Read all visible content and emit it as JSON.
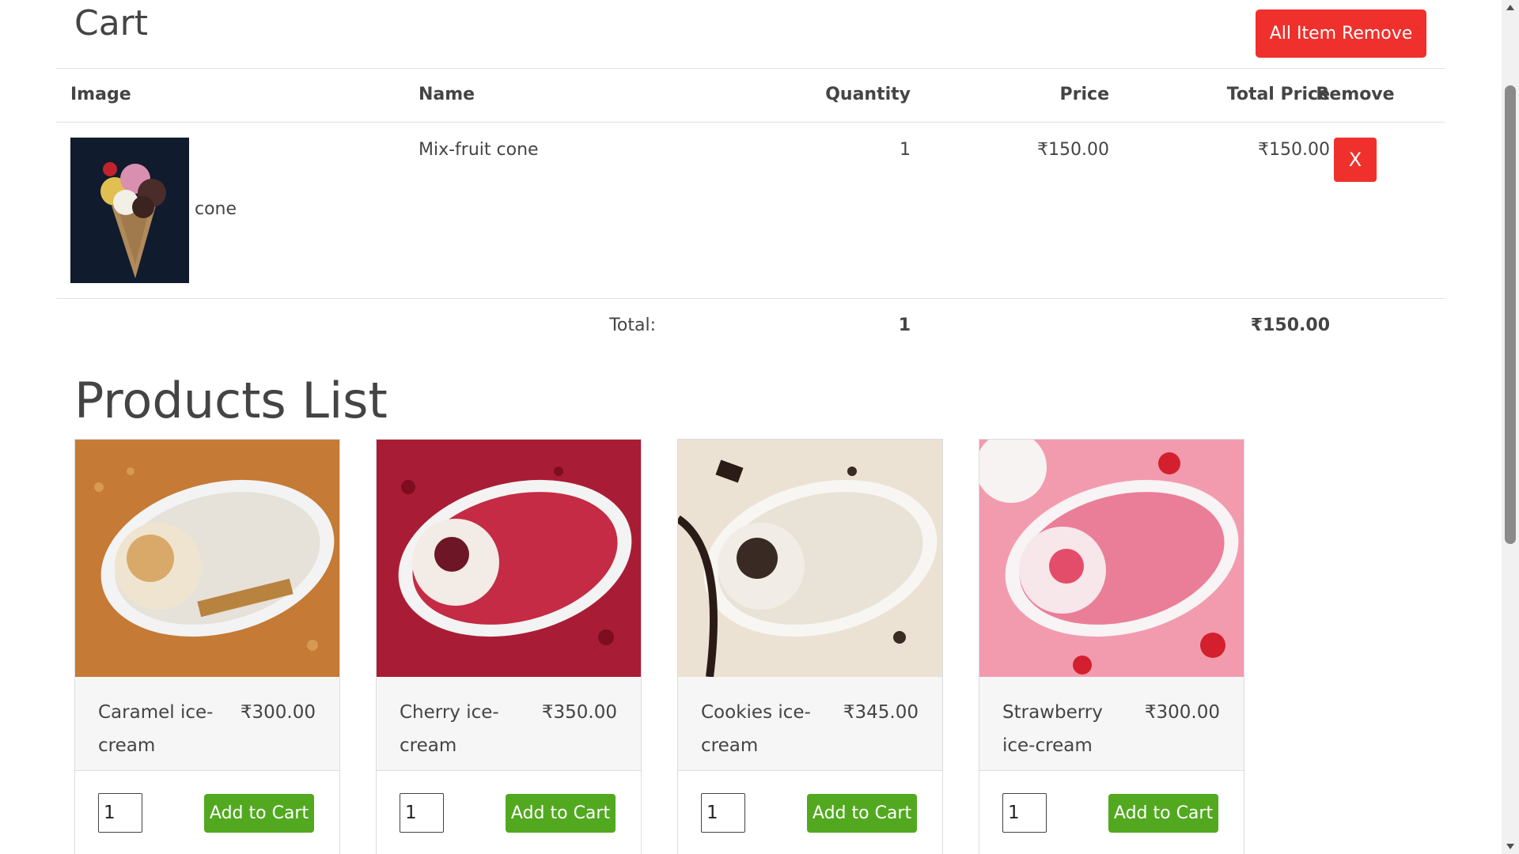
{
  "cart": {
    "title": "Cart",
    "remove_all_label": "All Item Remove",
    "columns": {
      "image": "Image",
      "name": "Name",
      "quantity": "Quantity",
      "price": "Price",
      "total_price": "Total Price",
      "remove": "Remove"
    },
    "items": [
      {
        "image_alt": "cone",
        "name": "Mix-fruit cone",
        "quantity": "1",
        "price": "₹150.00",
        "total_price": "₹150.00",
        "remove_label": "X"
      }
    ],
    "total_label": "Total:",
    "total_quantity": "1",
    "total_amount": "₹150.00"
  },
  "products": {
    "title": "Products List",
    "items": [
      {
        "name": "Caramel ice-cream",
        "price": "₹300.00",
        "quantity": "1",
        "add_label": "Add to Cart",
        "image_color": "#c57a35"
      },
      {
        "name": "Cherry ice-cream",
        "price": "₹350.00",
        "quantity": "1",
        "add_label": "Add to Cart",
        "image_color": "#a81d35"
      },
      {
        "name": "Cookies ice-cream",
        "price": "₹345.00",
        "quantity": "1",
        "add_label": "Add to Cart",
        "image_color": "#ece2d3"
      },
      {
        "name": "Strawberry ice-cream",
        "price": "₹300.00",
        "quantity": "1",
        "add_label": "Add to Cart",
        "image_color": "#f29bae"
      }
    ]
  },
  "colors": {
    "danger": "#f0302c",
    "success": "#52a91f",
    "text": "#444444"
  }
}
